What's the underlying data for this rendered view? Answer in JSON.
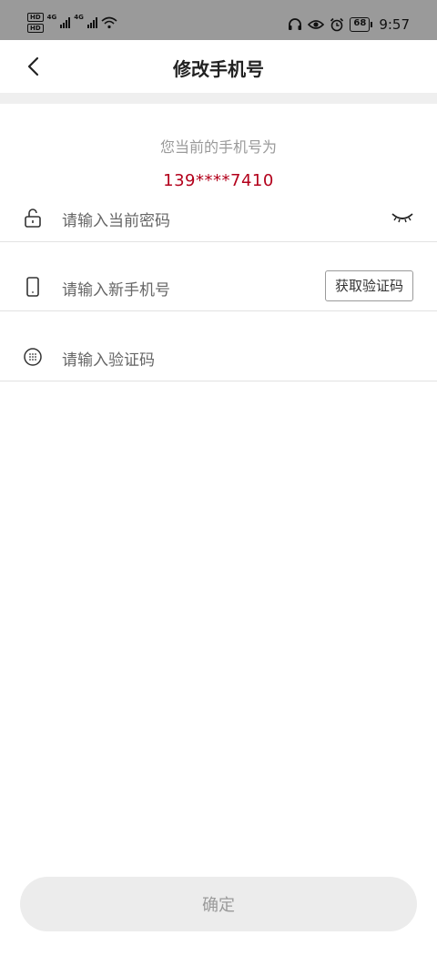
{
  "status_bar": {
    "hd1": "HD",
    "hd2": "HD",
    "net1": "4G",
    "net2": "4G",
    "battery": "68",
    "time": "9:57",
    "icons": [
      "headphones-icon",
      "eye-icon",
      "alarm-icon",
      "wifi-icon",
      "signal-icon"
    ]
  },
  "nav": {
    "title": "修改手机号",
    "back_icon": "chevron-left-icon"
  },
  "current": {
    "label": "您当前的手机号为",
    "phone": "139****7410"
  },
  "form": {
    "password": {
      "placeholder": "请输入当前密码",
      "icon": "unlock-icon",
      "toggle_icon": "eye-closed-icon"
    },
    "new_phone": {
      "placeholder": "请输入新手机号",
      "icon": "phone-icon",
      "button": "获取验证码"
    },
    "code": {
      "placeholder": "请输入验证码",
      "icon": "keypad-icon"
    }
  },
  "confirm": {
    "label": "确定"
  },
  "colors": {
    "accent": "#b3001b",
    "status_bar": "#9a9a9a",
    "divider": "#e2e2e2"
  }
}
